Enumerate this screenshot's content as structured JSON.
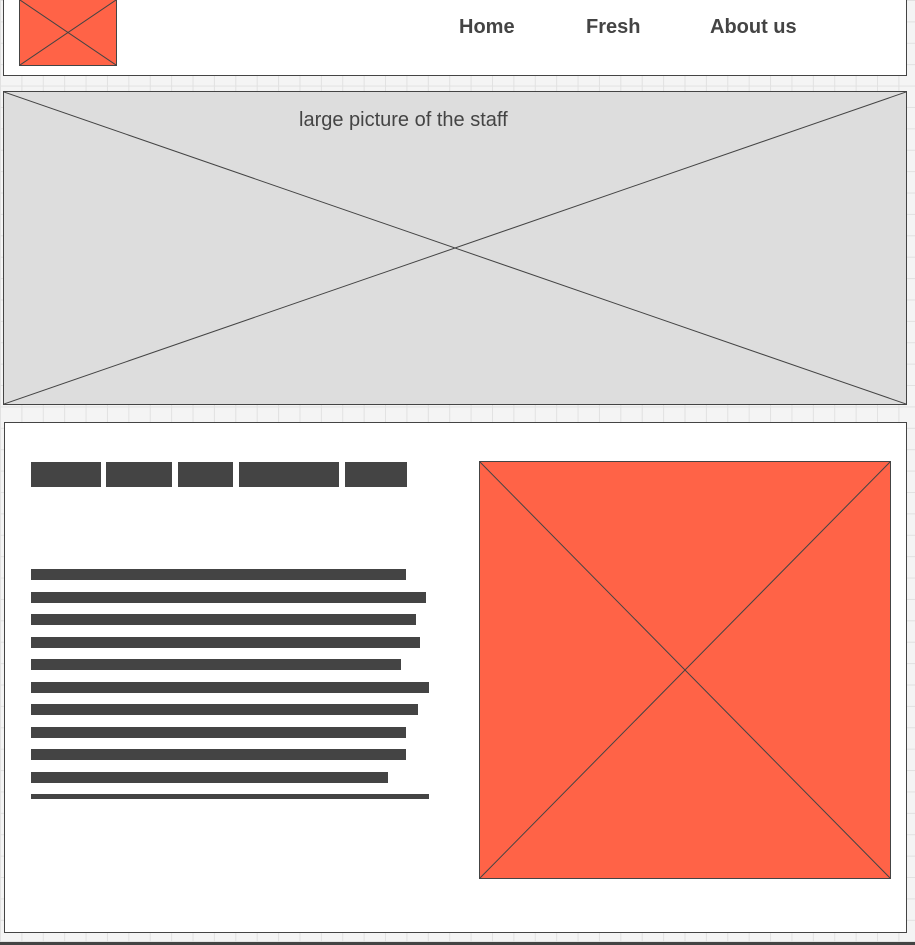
{
  "header": {
    "logo_icon": "placeholder-image-icon",
    "nav": [
      {
        "label": "Home"
      },
      {
        "label": "Fresh"
      },
      {
        "label": "About us"
      }
    ]
  },
  "hero": {
    "caption": "large picture of the staff",
    "image_icon": "placeholder-image-icon"
  },
  "content": {
    "tab_count": 5,
    "text_line_count": 11,
    "image_icon": "placeholder-image-icon"
  },
  "colors": {
    "accent": "#ff6347",
    "ink": "#444444",
    "hero_fill": "#dddddd",
    "grid_background": "#f4f4f4"
  }
}
